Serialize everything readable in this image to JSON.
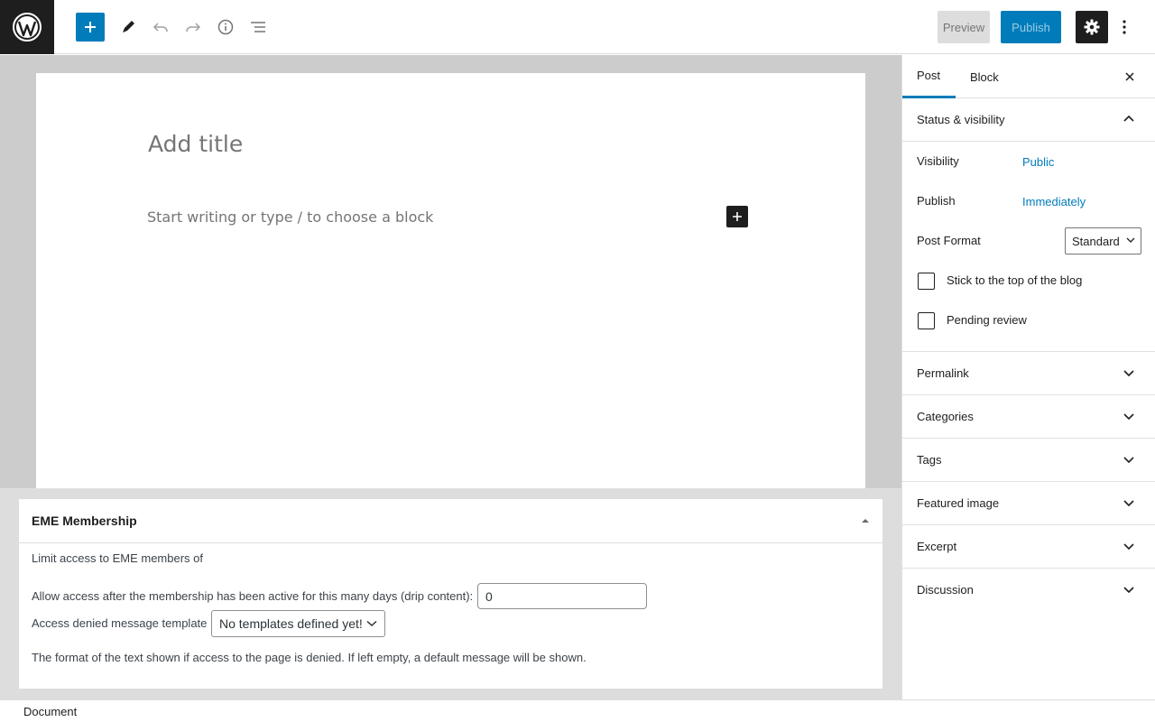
{
  "toolbar": {
    "logo_icon": "wordpress-logo-icon",
    "add_block_icon": "plus-icon",
    "tools_icon": "pencil-icon",
    "undo_icon": "undo-icon",
    "redo_icon": "redo-icon",
    "details_icon": "info-icon",
    "outline_icon": "list-view-icon",
    "preview_label": "Preview",
    "publish_label": "Publish",
    "settings_icon": "gear-icon",
    "more_icon": "more-vertical-icon"
  },
  "editor": {
    "title_placeholder": "Add title",
    "block_placeholder": "Start writing or type / to choose a block"
  },
  "metabox": {
    "title": "EME Membership",
    "limit_text": "Limit access to EME members of",
    "drip_label": "Allow access after the membership has been active for this many days (drip content):",
    "drip_value": "0",
    "template_label": "Access denied message template",
    "template_value": "No templates defined yet!",
    "format_help": "The format of the text shown if access to the page is denied. If left empty, a default message will be shown."
  },
  "footer": {
    "breadcrumb": "Document"
  },
  "sidebar": {
    "tabs": [
      {
        "label": "Post",
        "active": true
      },
      {
        "label": "Block",
        "active": false
      }
    ],
    "status_panel": {
      "title": "Status & visibility",
      "visibility_label": "Visibility",
      "visibility_value": "Public",
      "publish_label": "Publish",
      "publish_value": "Immediately",
      "format_label": "Post Format",
      "format_value": "Standard",
      "sticky_label": "Stick to the top of the blog",
      "pending_label": "Pending review"
    },
    "panels": [
      {
        "label": "Permalink"
      },
      {
        "label": "Categories"
      },
      {
        "label": "Tags"
      },
      {
        "label": "Featured image"
      },
      {
        "label": "Excerpt"
      },
      {
        "label": "Discussion"
      }
    ]
  },
  "colors": {
    "accent": "#007cba",
    "dark": "#1e1e1e",
    "canvas_bg": "#cccccc"
  }
}
